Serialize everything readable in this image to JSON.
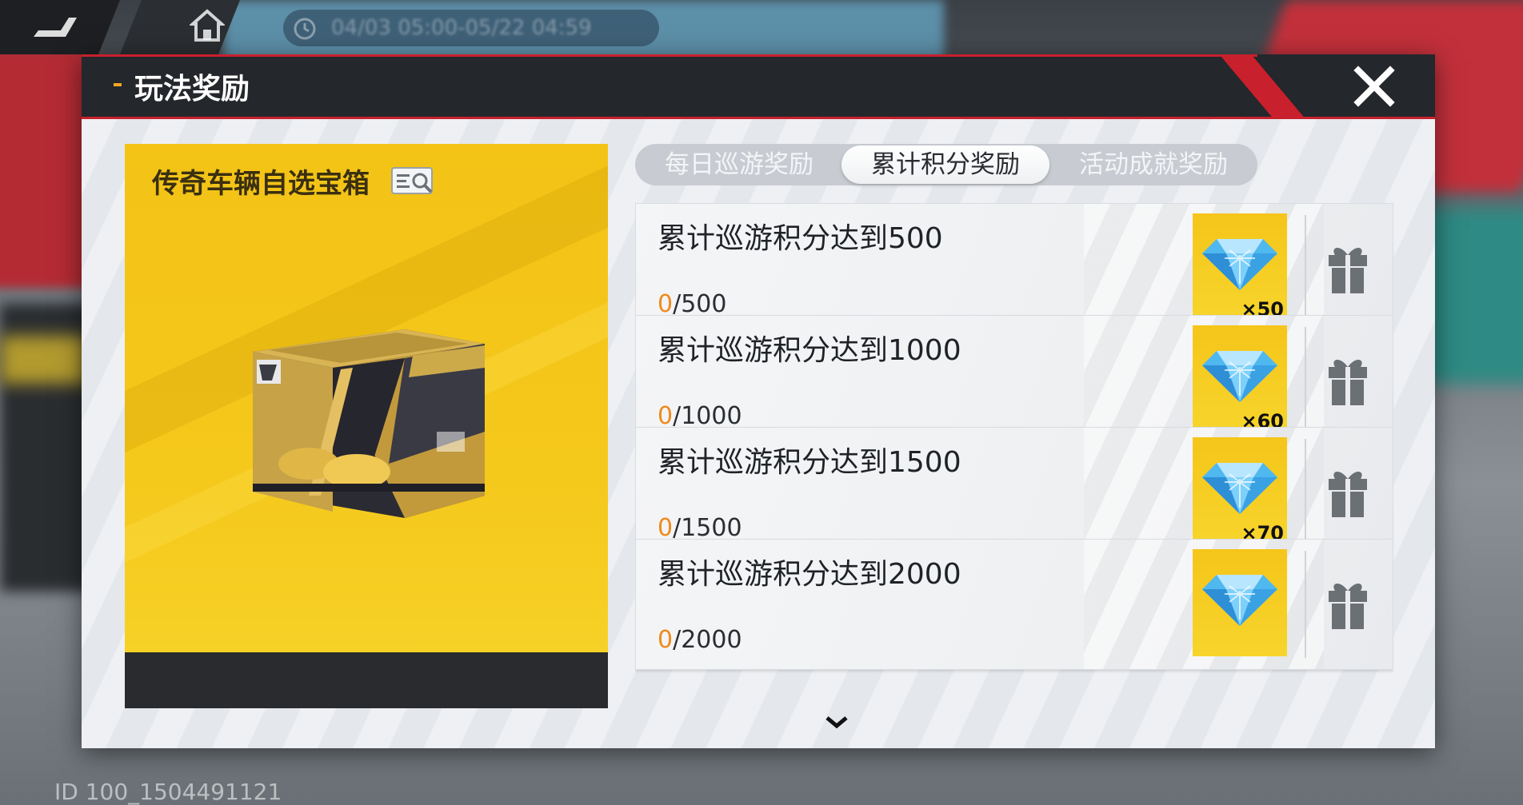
{
  "background": {
    "event_time": "04/03 05:00-05/22 04:59"
  },
  "modal": {
    "title": "玩法奖励",
    "chest": {
      "name": "传奇车辆自选宝箱"
    },
    "tabs": [
      {
        "label": "每日巡游奖励",
        "active": false
      },
      {
        "label": "累计积分奖励",
        "active": true
      },
      {
        "label": "活动成就奖励",
        "active": false
      }
    ],
    "tasks": [
      {
        "title": "累计巡游积分达到500",
        "current": "0",
        "target": "/500",
        "reward_qty": "×50"
      },
      {
        "title": "累计巡游积分达到1000",
        "current": "0",
        "target": "/1000",
        "reward_qty": "×60"
      },
      {
        "title": "累计巡游积分达到1500",
        "current": "0",
        "target": "/1500",
        "reward_qty": "×70"
      },
      {
        "title": "累计巡游积分达到2000",
        "current": "0",
        "target": "/2000",
        "reward_qty": ""
      }
    ]
  },
  "footer": {
    "uid": "ID 100_1504491121"
  },
  "colors": {
    "accent_red": "#c8202c",
    "progress_orange": "#f08a1b",
    "chest_yellow": "#f5c51a",
    "header_dark": "#24272b"
  },
  "icons": [
    "back-icon",
    "home-icon",
    "clock-icon",
    "close-icon",
    "magnify-icon",
    "diamond-icon",
    "gift-icon",
    "chevron-down-icon"
  ]
}
